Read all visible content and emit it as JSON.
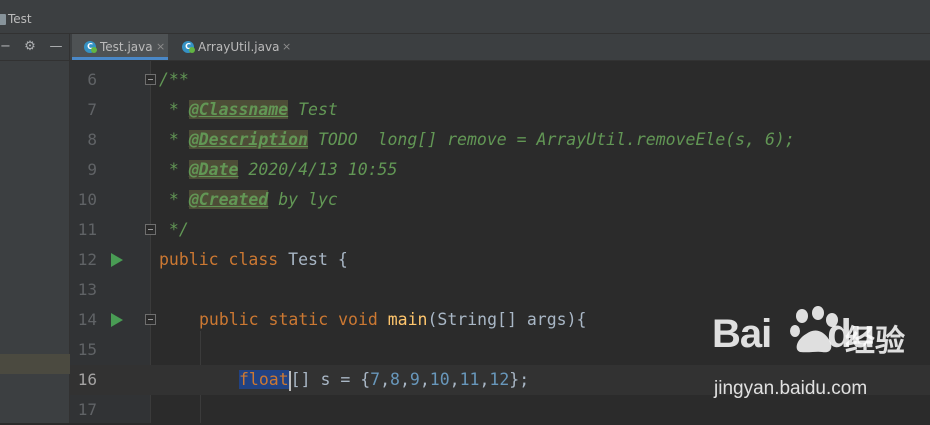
{
  "breadcrumb": {
    "label": "Test"
  },
  "tabs": [
    {
      "label": "Test.java",
      "active": true,
      "icon": "java-class-icon"
    },
    {
      "label": "ArrayUtil.java",
      "active": false,
      "icon": "java-class-icon"
    }
  ],
  "toolbar": {
    "collapse_glyph": "−",
    "settings_glyph": "⚙",
    "hide_glyph": "—",
    "plus_glyph": "+"
  },
  "close_glyph": "×",
  "lines": [
    {
      "no": "6"
    },
    {
      "no": "7"
    },
    {
      "no": "8"
    },
    {
      "no": "9"
    },
    {
      "no": "10"
    },
    {
      "no": "11"
    },
    {
      "no": "12"
    },
    {
      "no": "13"
    },
    {
      "no": "14"
    },
    {
      "no": "15"
    },
    {
      "no": "16"
    },
    {
      "no": "17"
    }
  ],
  "code": {
    "l6": "/**",
    "l7_prefix": " * ",
    "l7_tag": "@Classname",
    "l7_text": " Test",
    "l8_prefix": " * ",
    "l8_tag": "@Description",
    "l8_text": " TODO  long[] remove = ArrayUtil.removeEle(s, 6);",
    "l9_prefix": " * ",
    "l9_tag": "@Date",
    "l9_text": " 2020/4/13 10:55",
    "l10_prefix": " * ",
    "l10_tag": "@Created",
    "l10_text": " by lyc",
    "l11": " */",
    "l12_kw": "public class",
    "l12_rest": " Test {",
    "l14_kw": "public static void",
    "l14_meth": "main",
    "l14_rest": "(String[] args){",
    "l16_kw": "float",
    "l16_a": "[] s = {",
    "l16_n1": "7",
    "l16_n2": "8",
    "l16_n3": "9",
    "l16_n4": "10",
    "l16_n5": "11",
    "l16_n6": "12",
    "l16_end": "};",
    "comma": ","
  },
  "watermark": {
    "logo": "Bai",
    "logo2": "du",
    "cn": "经验",
    "url": "jingyan.baidu.com"
  },
  "colors": {
    "keyword": "#cc7832",
    "doc": "#629755",
    "number": "#6897bb",
    "method": "#ffc66d",
    "run": "#499c54"
  }
}
